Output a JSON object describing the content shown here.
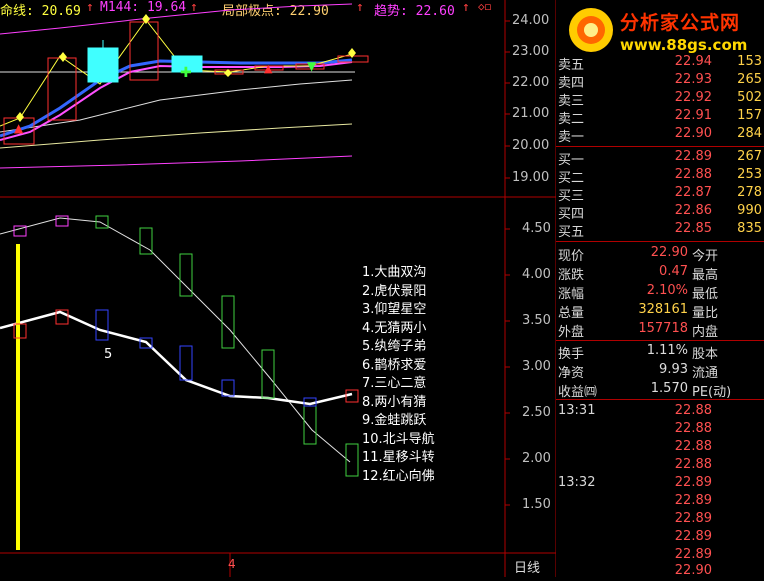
{
  "header": {
    "ma_label": "命线: 20.69",
    "ma_arrow": "↑",
    "m144_label": "M144: 19.64",
    "m144_arrow": "↑",
    "local_pole_label": "局部极点: 22.90",
    "local_pole_arrow": "↑",
    "trend_label": "趋势: 22.60",
    "trend_arrow": "↑",
    "trend_markers": "◇◻"
  },
  "price_axis": [
    "24.00",
    "23.00",
    "22.00",
    "21.00",
    "20.00",
    "19.00"
  ],
  "indicator_axis": [
    "4.50",
    "4.00",
    "3.50",
    "3.00",
    "2.50",
    "2.00",
    "1.50"
  ],
  "indicator_annotation": "5",
  "legend": [
    "1.大曲双沟",
    "2.虎伏景阳",
    "3.仰望星空",
    "4.无猜两小",
    "5.纨绔子弟",
    "6.鹊桥求爱",
    "7.三心二意",
    "8.两小有猜",
    "9.金蛙跳跃",
    "10.北斗导航",
    "11.星移斗转",
    "12.红心向佛"
  ],
  "bottom": {
    "marker": "4",
    "period_label": "日线"
  },
  "logo": {
    "title": "分析家公式网",
    "url": "www.88gs.com"
  },
  "order_book": {
    "asks": [
      {
        "label": "卖五",
        "price": "22.94",
        "vol": "153"
      },
      {
        "label": "卖四",
        "price": "22.93",
        "vol": "265"
      },
      {
        "label": "卖三",
        "price": "22.92",
        "vol": "502"
      },
      {
        "label": "卖二",
        "price": "22.91",
        "vol": "157"
      },
      {
        "label": "卖一",
        "price": "22.90",
        "vol": "284"
      }
    ],
    "bids": [
      {
        "label": "买一",
        "price": "22.89",
        "vol": "267"
      },
      {
        "label": "买二",
        "price": "22.88",
        "vol": "253"
      },
      {
        "label": "买三",
        "price": "22.87",
        "vol": "278"
      },
      {
        "label": "买四",
        "price": "22.86",
        "vol": "990"
      },
      {
        "label": "买五",
        "price": "22.85",
        "vol": "835"
      }
    ]
  },
  "stats": [
    {
      "label": "现价",
      "value": "22.90",
      "right": "今开"
    },
    {
      "label": "涨跌",
      "value": "0.47",
      "right": "最高"
    },
    {
      "label": "涨幅",
      "value": "2.10%",
      "right": "最低"
    },
    {
      "label": "总量",
      "value": "328161",
      "right": "量比"
    },
    {
      "label": "外盘",
      "value": "157718",
      "right": "内盘"
    }
  ],
  "stats2": [
    {
      "label": "换手",
      "value": "1.11%",
      "right": "股本"
    },
    {
      "label": "净资",
      "value": "9.93",
      "right": "流通"
    },
    {
      "label": "收益㈣",
      "value": "1.570",
      "right": "PE(动)"
    }
  ],
  "ticks": [
    {
      "time": "13:31",
      "price": "22.88"
    },
    {
      "time": "",
      "price": "22.88"
    },
    {
      "time": "",
      "price": "22.88"
    },
    {
      "time": "",
      "price": "22.88"
    },
    {
      "time": "13:32",
      "price": "22.89"
    },
    {
      "time": "",
      "price": "22.89"
    },
    {
      "time": "",
      "price": "22.89"
    },
    {
      "time": "",
      "price": "22.89"
    },
    {
      "time": "",
      "price": "22.89"
    },
    {
      "time": "",
      "price": "22.90"
    }
  ],
  "colors": {
    "up": "#ff3030",
    "down": "#00c0ff",
    "ma_blue": "#3366ff",
    "ma_magenta": "#ff40ff",
    "yellow": "#ffff00"
  }
}
